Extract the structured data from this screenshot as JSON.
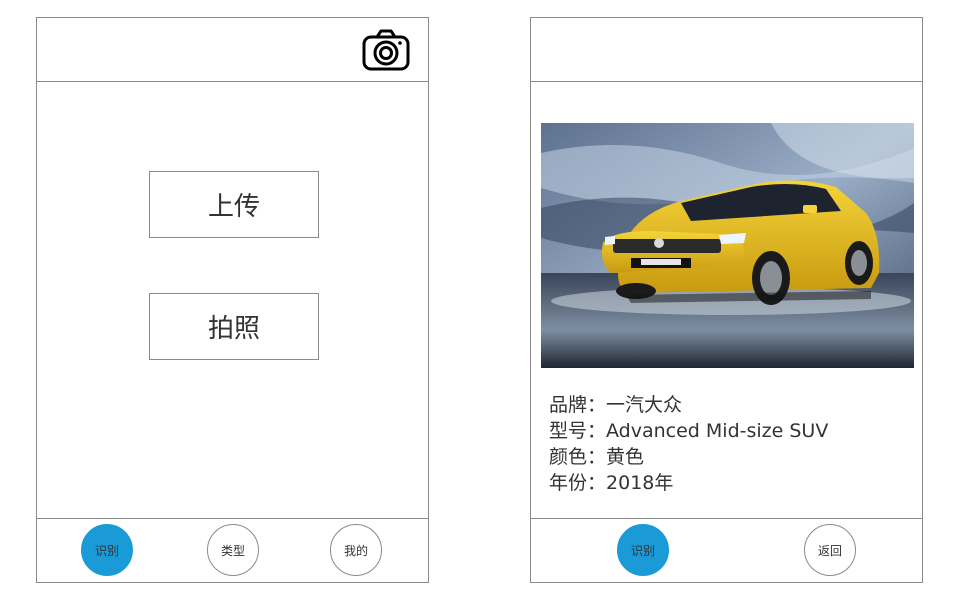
{
  "left_screen": {
    "actions": {
      "upload_label": "上传",
      "photo_label": "拍照"
    },
    "nav": {
      "recognize": "识别",
      "types": "类型",
      "mine": "我的"
    },
    "colors": {
      "active_nav": "#1a9ad6"
    },
    "icons": {
      "camera": "camera-icon"
    }
  },
  "right_screen": {
    "result": {
      "brand_label": "品牌：",
      "brand_value": "一汽大众",
      "model_label": "型号：",
      "model_value": "Advanced Mid-size SUV",
      "color_label": "颜色：",
      "color_value": "黄色",
      "year_label": "年份：",
      "year_value": "2018年"
    },
    "nav": {
      "recognize": "识别",
      "back": "返回"
    },
    "image": "yellow-suv-photo"
  }
}
